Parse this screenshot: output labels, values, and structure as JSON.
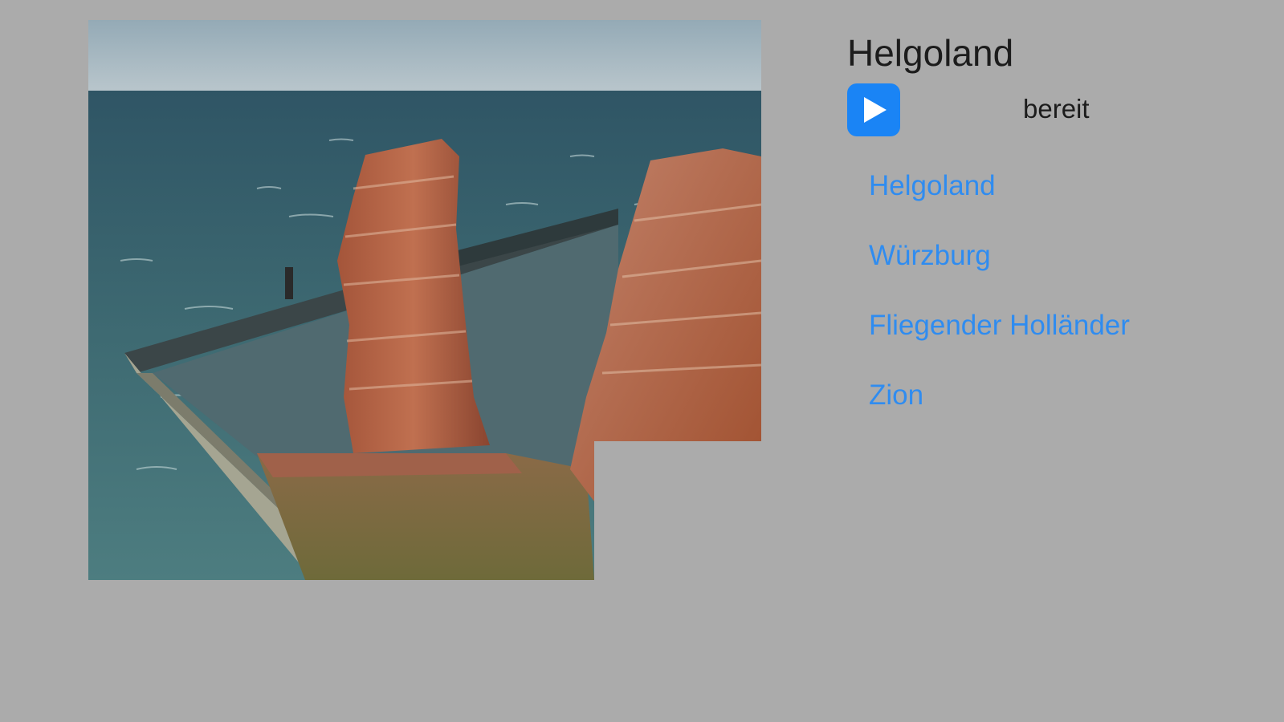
{
  "player": {
    "title": "Helgoland",
    "play_icon": "play-icon",
    "status": "bereit"
  },
  "colors": {
    "background": "#ababab",
    "accent": "#1a84f5",
    "link": "#2f8cf0"
  },
  "playlist": [
    {
      "label": "Helgoland"
    },
    {
      "label": "Würzburg"
    },
    {
      "label": "Fliegender Holländer"
    },
    {
      "label": "Zion"
    }
  ]
}
